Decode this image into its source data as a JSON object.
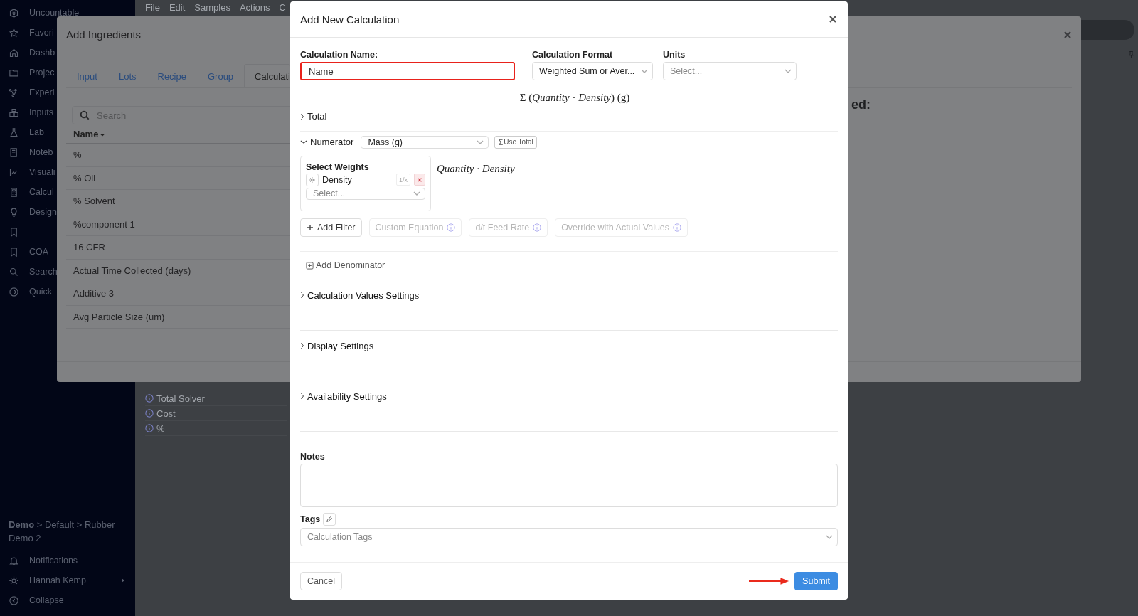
{
  "sidebar": {
    "items": [
      {
        "kind": "link",
        "label": "Uncountable"
      },
      {
        "kind": "link",
        "label": "Favori"
      },
      {
        "kind": "link",
        "label": "Dashb"
      },
      {
        "kind": "link",
        "label": "Projec"
      },
      {
        "kind": "link",
        "label": "Experi"
      },
      {
        "kind": "link",
        "label": "Inputs"
      },
      {
        "kind": "link",
        "label": "Lab"
      },
      {
        "kind": "link",
        "label": "Noteb"
      },
      {
        "kind": "link",
        "label": "Visuali"
      },
      {
        "kind": "link",
        "label": "Calcul"
      },
      {
        "kind": "link",
        "label": "Design"
      },
      {
        "kind": "icon"
      },
      {
        "kind": "link",
        "label": "COA"
      },
      {
        "kind": "link",
        "label": "Search"
      },
      {
        "kind": "link",
        "label": "Quick"
      }
    ],
    "breadcrumb": "**Demo** > Default > Rubber Demo 2",
    "footer_items": [
      {
        "label": "Notifications",
        "has_submenu": false
      },
      {
        "label": "Hannah Kemp",
        "has_submenu": true
      },
      {
        "label": "Collapse",
        "has_submenu": false
      }
    ]
  },
  "menu_bar": [
    "File",
    "Edit",
    "Samples",
    "Actions",
    "C"
  ],
  "background_list": [
    "Total Solver",
    "Cost",
    "%"
  ],
  "ingredients_dialog": {
    "title": "Add Ingredients",
    "tabs": [
      {
        "label": "Input",
        "selected": false
      },
      {
        "label": "Lots",
        "selected": false
      },
      {
        "label": "Recipe",
        "selected": false
      },
      {
        "label": "Group",
        "selected": false
      },
      {
        "label": "Calculati",
        "selected": true
      }
    ],
    "search": {
      "placeholder": "Search"
    },
    "column": "Name",
    "rows": [
      "%",
      "% Oil",
      "% Solvent",
      "%component 1",
      "16 CFR",
      "Actual Time Collected (days)",
      "Additive 3",
      "Avg Particle Size (um)"
    ],
    "side_text": "ed:"
  },
  "calc_dialog": {
    "title": "Add New Calculation",
    "name_field": {
      "label": "Calculation Name:",
      "value": "Name",
      "highlighted": true
    },
    "format_field": {
      "label": "Calculation Format",
      "value": "Weighted Sum or Aver..."
    },
    "units_field": {
      "label": "Units",
      "placeholder": "Select..."
    },
    "formula": "Σ (*Quantity* · *Density*)  (g)",
    "total": {
      "label": "Total",
      "expanded": false
    },
    "numerator": {
      "label": "Numerator",
      "expanded": true,
      "select": "Mass (g)",
      "use_total": {
        "symbol": "Σ",
        "label": "Use Total"
      },
      "weights": {
        "title": "Select Weights",
        "items": [
          {
            "name": "Density",
            "invert": "1/x"
          }
        ],
        "placeholder": "Select..."
      },
      "formula": "Quantity · Density",
      "actions": [
        {
          "label": "Add Filter",
          "disabled": false
        },
        {
          "label": "Custom Equation",
          "disabled": true
        },
        {
          "label": "d/t Feed Rate",
          "disabled": true
        },
        {
          "label": "Override with Actual Values",
          "disabled": true
        }
      ]
    },
    "add_denominator": "Add Denominator",
    "sections": [
      {
        "label": "Calculation Values Settings",
        "expanded": false
      },
      {
        "label": "Display Settings",
        "expanded": false
      },
      {
        "label": "Availability Settings",
        "expanded": false
      }
    ],
    "notes_label": "Notes",
    "tags_label": "Tags",
    "tags_placeholder": "Calculation Tags",
    "cancel": "Cancel",
    "submit": "Submit"
  }
}
